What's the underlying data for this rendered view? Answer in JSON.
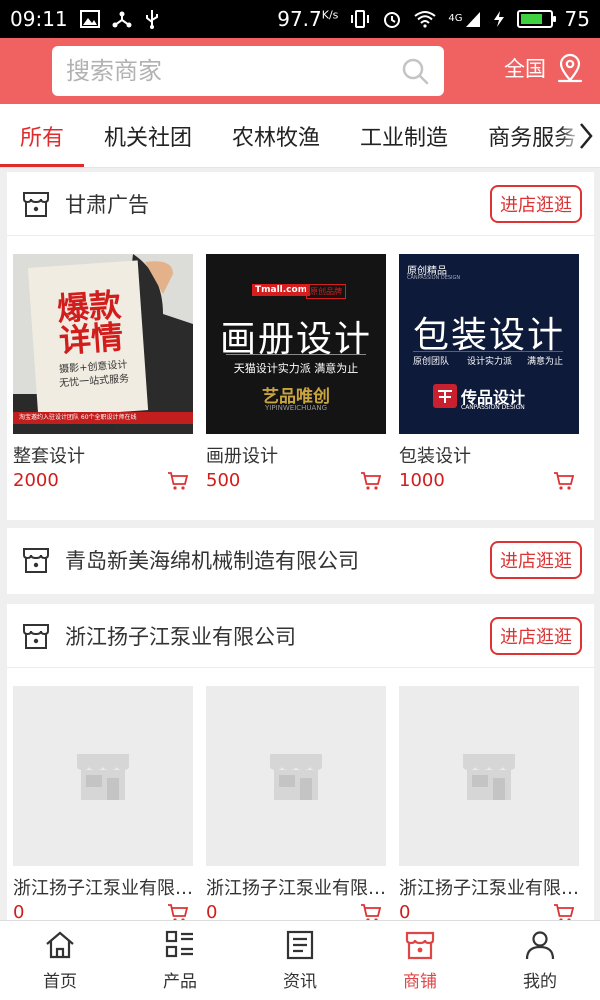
{
  "status_bar": {
    "time": "09:11",
    "speed": "97.7",
    "speed_unit": "K/s",
    "network": "4G",
    "battery": "75",
    "battery_level": 0.75
  },
  "search": {
    "placeholder": "搜索商家"
  },
  "region": {
    "label": "全国"
  },
  "tabs": [
    {
      "label": "所有"
    },
    {
      "label": "机关社团"
    },
    {
      "label": "农林牧渔"
    },
    {
      "label": "工业制造"
    },
    {
      "label": "商务服务"
    }
  ],
  "shops": [
    {
      "name": "甘肃广告",
      "button": "进店逛逛",
      "products": [
        {
          "title": "整套设计",
          "price": "2000",
          "img_text_1": "爆款",
          "img_text_2": "详情",
          "img_caption_1": "摄影+创意设计",
          "img_caption_2": "无忧一站式服务",
          "img_footer": "淘宝邀约入驻设计团队 60个全职设计师在线"
        },
        {
          "title": "画册设计",
          "price": "500",
          "img_brand": "Tmall.com",
          "img_tag": "原创品牌",
          "img_main": "画册设计",
          "img_sub": "天猫设计实力派 满意为止",
          "img_logo": "艺品唯创",
          "img_logo_en": "YIPINWEICHUANG"
        },
        {
          "title": "包装设计",
          "price": "1000",
          "img_tag": "原创精品",
          "img_tag_en": "CANPASSION DESIGN",
          "img_main": "包装设计",
          "img_sub_1": "原创团队",
          "img_sub_2": "设计实力派",
          "img_sub_3": "满意为止",
          "img_logo": "传品设计",
          "img_logo_en": "CANPASSION DESIGN"
        }
      ]
    },
    {
      "name": "青岛新美海绵机械制造有限公司",
      "button": "进店逛逛",
      "products": []
    },
    {
      "name": "浙江扬子江泵业有限公司",
      "button": "进店逛逛",
      "products": [
        {
          "title": "浙江扬子江泵业有限公司",
          "price": "0"
        },
        {
          "title": "浙江扬子江泵业有限公司",
          "price": "0"
        },
        {
          "title": "浙江扬子江泵业有限公司",
          "price": "0"
        }
      ]
    }
  ],
  "bottom_nav": [
    {
      "label": "首页",
      "icon": "home-icon"
    },
    {
      "label": "产品",
      "icon": "grid-list-icon"
    },
    {
      "label": "资讯",
      "icon": "news-icon"
    },
    {
      "label": "商铺",
      "icon": "store-icon",
      "active": true
    },
    {
      "label": "我的",
      "icon": "user-icon"
    }
  ],
  "colors": {
    "accent": "#f06161",
    "active_red": "#e02b2b",
    "price_red": "#d01e1e"
  }
}
